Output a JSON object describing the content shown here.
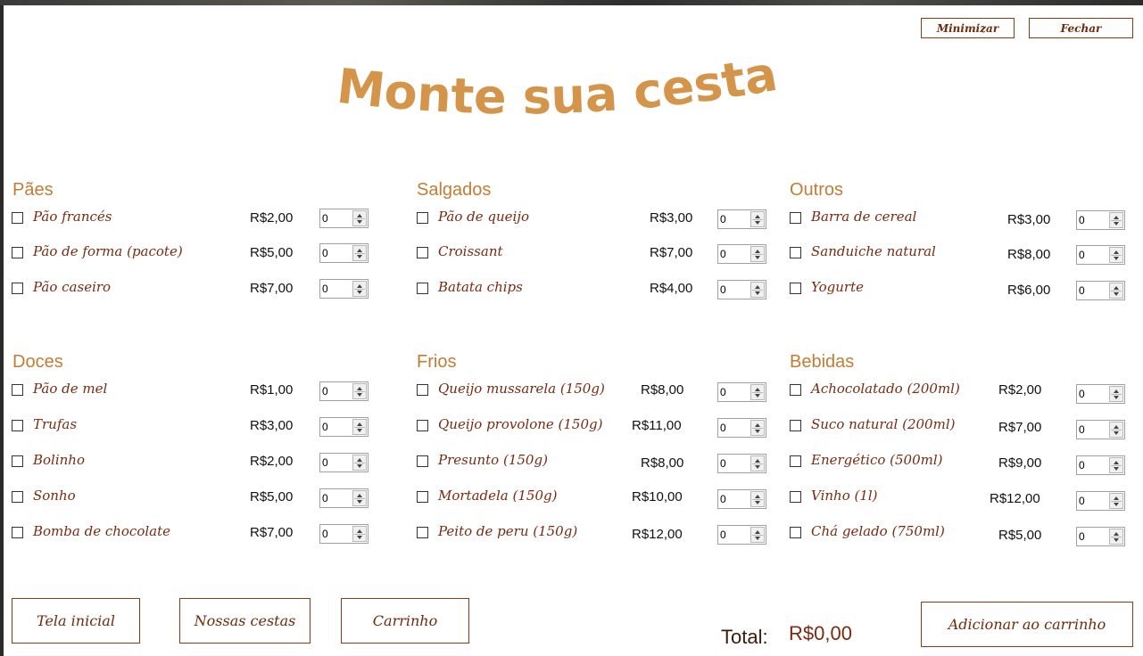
{
  "window": {
    "minimize_label": "Minimizar",
    "close_label": "Fechar",
    "title": "Monte sua cesta"
  },
  "categories": [
    {
      "title": "Pães",
      "items": [
        {
          "name": "Pão francés",
          "price": "R$2,00",
          "qty": "0"
        },
        {
          "name": "Pão de forma (pacote)",
          "price": "R$5,00",
          "qty": "0"
        },
        {
          "name": "Pão caseiro",
          "price": "R$7,00",
          "qty": "0"
        }
      ]
    },
    {
      "title": "Salgados",
      "items": [
        {
          "name": "Pão de queijo",
          "price": "R$3,00",
          "qty": "0"
        },
        {
          "name": "Croissant",
          "price": "R$7,00",
          "qty": "0"
        },
        {
          "name": "Batata chips",
          "price": "R$4,00",
          "qty": "0"
        }
      ]
    },
    {
      "title": "Outros",
      "items": [
        {
          "name": "Barra de cereal",
          "price": "R$3,00",
          "qty": "0"
        },
        {
          "name": "Sanduiche natural",
          "price": "R$8,00",
          "qty": "0"
        },
        {
          "name": "Yogurte",
          "price": "R$6,00",
          "qty": "0"
        }
      ]
    },
    {
      "title": "Doces",
      "items": [
        {
          "name": "Pão de mel",
          "price": "R$1,00",
          "qty": "0"
        },
        {
          "name": "Trufas",
          "price": "R$3,00",
          "qty": "0"
        },
        {
          "name": "Bolinho",
          "price": "R$2,00",
          "qty": "0"
        },
        {
          "name": "Sonho",
          "price": "R$5,00",
          "qty": "0"
        },
        {
          "name": "Bomba de chocolate",
          "price": "R$7,00",
          "qty": "0"
        }
      ]
    },
    {
      "title": "Frios",
      "items": [
        {
          "name": "Queijo mussarela (150g)",
          "price": "R$8,00",
          "qty": "0"
        },
        {
          "name": "Queijo provolone (150g)",
          "price": "R$11,00",
          "qty": "0"
        },
        {
          "name": "Presunto (150g)",
          "price": "R$8,00",
          "qty": "0"
        },
        {
          "name": "Mortadela (150g)",
          "price": "R$10,00",
          "qty": "0"
        },
        {
          "name": "Peito de peru (150g)",
          "price": "R$12,00",
          "qty": "0"
        }
      ]
    },
    {
      "title": "Bebidas",
      "items": [
        {
          "name": "Achocolatado (200ml)",
          "price": "R$2,00",
          "qty": "0"
        },
        {
          "name": "Suco natural (200ml)",
          "price": "R$7,00",
          "qty": "0"
        },
        {
          "name": "Energético (500ml)",
          "price": "R$9,00",
          "qty": "0"
        },
        {
          "name": "Vinho (1l)",
          "price": "R$12,00",
          "qty": "0"
        },
        {
          "name": "Chá gelado (750ml)",
          "price": "R$5,00",
          "qty": "0"
        }
      ]
    }
  ],
  "nav": {
    "home_label": "Tela inicial",
    "baskets_label": "Nossas cestas",
    "cart_label": "Carrinho",
    "add_label": "Adicionar ao carrinho"
  },
  "total": {
    "label": "Total:",
    "value": "R$0,00"
  },
  "colors": {
    "accent": "#c27d34",
    "item_text": "#7a2a10",
    "title": "#d4954a",
    "border": "#8a3b12"
  }
}
